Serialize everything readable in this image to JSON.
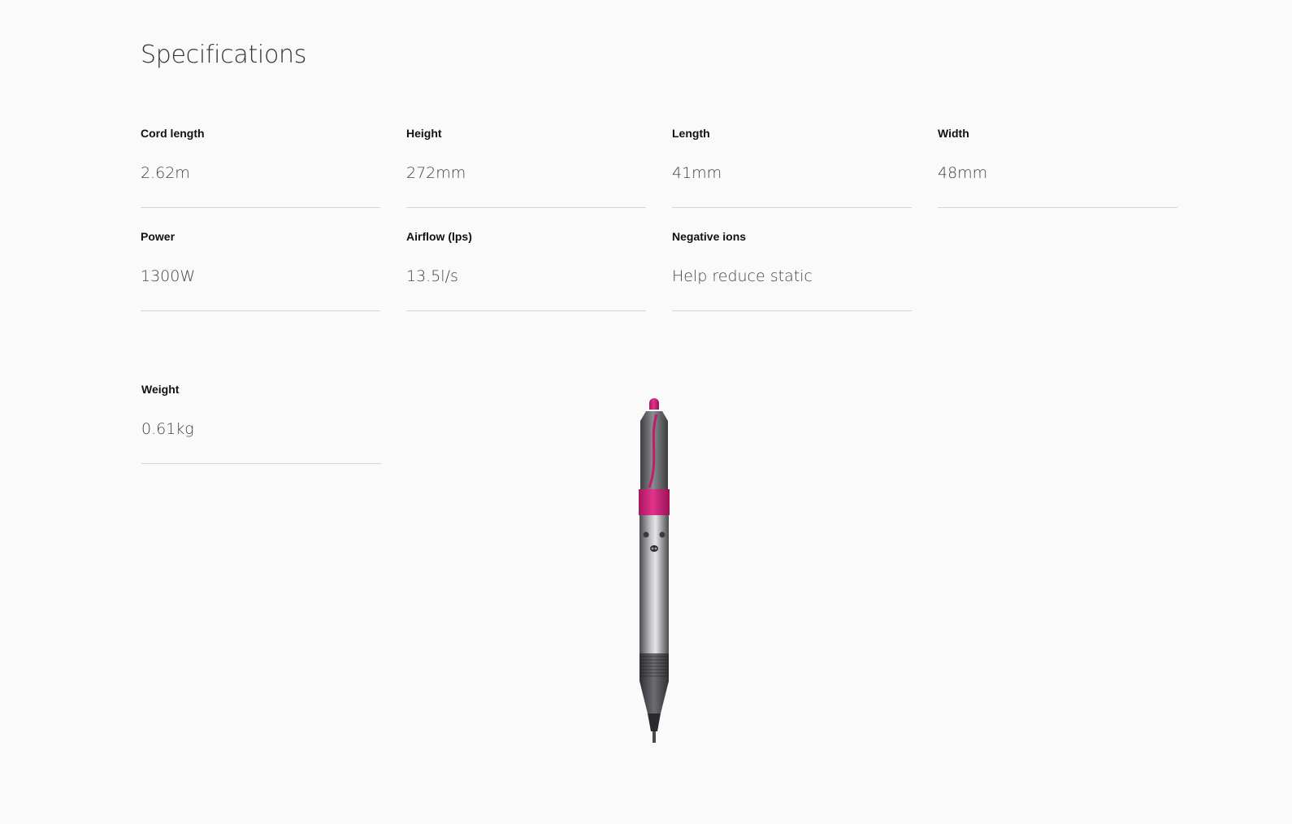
{
  "page": {
    "title": "Specifications"
  },
  "specs": [
    {
      "label": "Cord length",
      "value": "2.62m"
    },
    {
      "label": "Height",
      "value": "272mm"
    },
    {
      "label": "Length",
      "value": "41mm"
    },
    {
      "label": "Width",
      "value": "48mm"
    },
    {
      "label": "Power",
      "value": "1300W"
    },
    {
      "label": "Airflow (lps)",
      "value": "13.5l/s"
    },
    {
      "label": "Negative ions",
      "value": "Help reduce static"
    },
    {
      "label": "Weight",
      "value": "0.61kg"
    }
  ],
  "colors": {
    "accent": "#d0247a",
    "body": "#6e6e72",
    "background": "#fafafa"
  },
  "product_image": {
    "icon": "hair-styler-product-icon"
  }
}
